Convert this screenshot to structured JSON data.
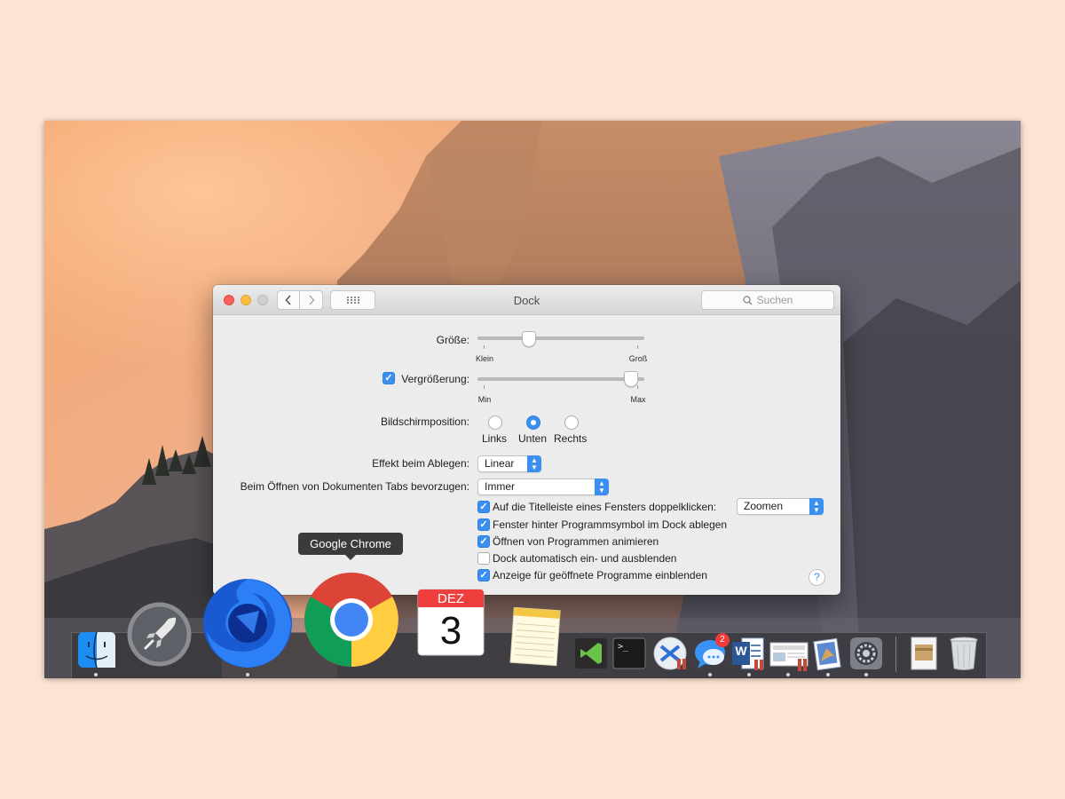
{
  "window": {
    "title": "Dock",
    "search_placeholder": "Suchen"
  },
  "settings": {
    "size_label": "Größe:",
    "size_min_label": "Klein",
    "size_max_label": "Groß",
    "size_value": 0.29,
    "magnification_label": "Vergrößerung:",
    "magnification_checked": true,
    "magnification_min_label": "Min",
    "magnification_max_label": "Max",
    "magnification_value": 0.96,
    "position_label": "Bildschirmposition:",
    "position_options": [
      "Links",
      "Unten",
      "Rechts"
    ],
    "position_selected": "Unten",
    "minimize_effect_label": "Effekt beim Ablegen:",
    "minimize_effect_value": "Linear",
    "tabs_label": "Beim Öffnen von Dokumenten Tabs bevorzugen:",
    "tabs_value": "Immer",
    "doubleclick_label": "Auf die Titelleiste eines Fensters doppelklicken:",
    "doubleclick_checked": true,
    "doubleclick_value": "Zoomen",
    "minimize_into_app_label": "Fenster hinter Programmsymbol im Dock ablegen",
    "minimize_into_app_checked": true,
    "animate_label": "Öffnen von Programmen animieren",
    "animate_checked": true,
    "autohide_label": "Dock automatisch ein- und ausblenden",
    "autohide_checked": false,
    "indicators_label": "Anzeige für geöffnete Programme einblenden",
    "indicators_checked": true,
    "help_label": "?"
  },
  "dock": {
    "tooltip": "Google Chrome",
    "calendar_month": "DEZ",
    "calendar_day": "3",
    "messages_badge": "2",
    "word_letter": "W",
    "terminal_prompt": ">_",
    "apps": [
      "finder",
      "launchpad",
      "firefox-developer-edition",
      "google-chrome",
      "calendar",
      "notes",
      "visual-studio-code",
      "terminal",
      "remote-desktop",
      "messages",
      "microsoft-word",
      "preview",
      "mail",
      "system-preferences",
      "downloads",
      "trash"
    ]
  },
  "colors": {
    "accent": "#3b8ff0",
    "page_background": "#fce3d3"
  }
}
